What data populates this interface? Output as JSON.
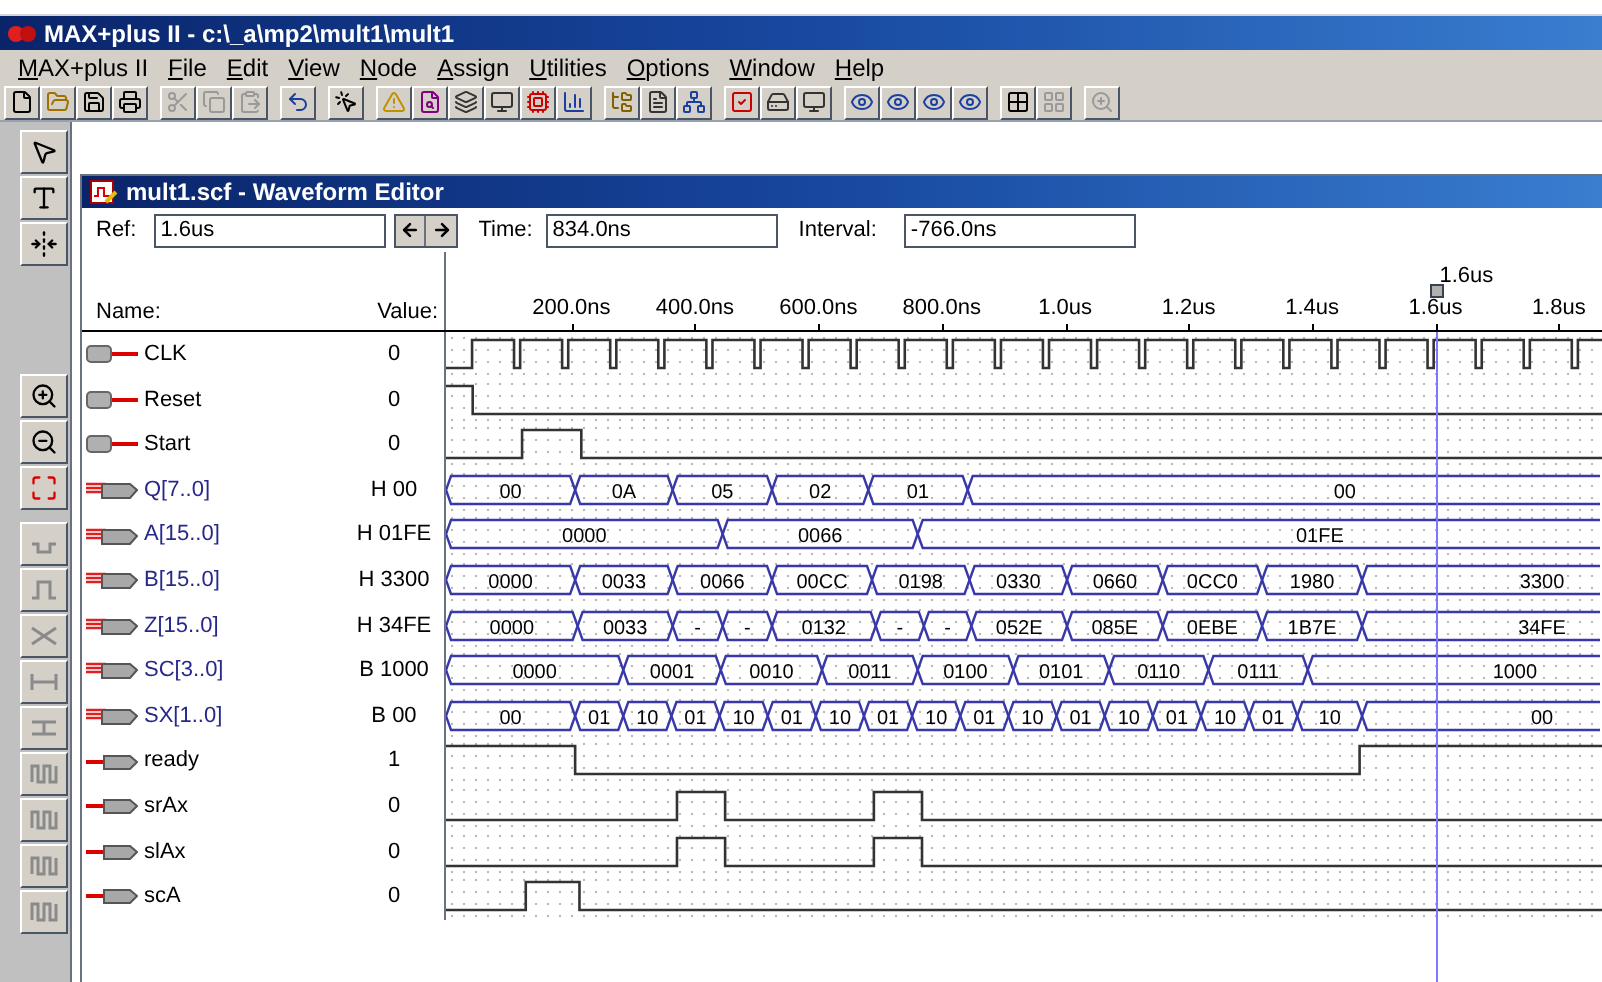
{
  "window": {
    "title": "MAX+plus II - c:\\_a\\mp2\\mult1\\mult1"
  },
  "menu": [
    "MAX+plus II",
    "File",
    "Edit",
    "View",
    "Node",
    "Assign",
    "Utilities",
    "Options",
    "Window",
    "Help"
  ],
  "editor": {
    "title": "mult1.scf - Waveform Editor",
    "ref": {
      "label": "Ref:",
      "value": "1.6us"
    },
    "time": {
      "label": "Time:",
      "value": "834.0ns"
    },
    "interval": {
      "label": "Interval:",
      "value": "-766.0ns"
    },
    "name_header": "Name:",
    "value_header": "Value:",
    "cursor_label": "1.6us",
    "ticks": [
      "200.0ns",
      "400.0ns",
      "600.0ns",
      "800.0ns",
      "1.0us",
      "1.2us",
      "1.4us",
      "1.6us",
      "1.8us"
    ],
    "signals": [
      {
        "name": "CLK",
        "kind": "clock",
        "value": "0"
      },
      {
        "name": "Reset",
        "kind": "input",
        "value": "0"
      },
      {
        "name": "Start",
        "kind": "input",
        "value": "0"
      },
      {
        "name": "Q[7..0]",
        "kind": "bus",
        "value": "H 00",
        "segments": [
          "00",
          "0A",
          "05",
          "02",
          "01",
          "00"
        ]
      },
      {
        "name": "A[15..0]",
        "kind": "bus",
        "value": "H 01FE",
        "segments": [
          "0000",
          "0066",
          "01FE"
        ]
      },
      {
        "name": "B[15..0]",
        "kind": "bus",
        "value": "H 3300",
        "segments": [
          "0000",
          "0033",
          "0066",
          "00CC",
          "0198",
          "0330",
          "0660",
          "0CC0",
          "1980",
          "3300"
        ]
      },
      {
        "name": "Z[15..0]",
        "kind": "bus",
        "value": "H 34FE",
        "segments": [
          "0000",
          "0033",
          "-",
          "-",
          "0132",
          "-",
          "-",
          "052E",
          "085E",
          "0EBE",
          "1B7E",
          "34FE"
        ]
      },
      {
        "name": "SC[3..0]",
        "kind": "bus",
        "value": "B 1000",
        "segments": [
          "0000",
          "0001",
          "0010",
          "0011",
          "0100",
          "0101",
          "0110",
          "0111",
          "1000"
        ]
      },
      {
        "name": "SX[1..0]",
        "kind": "bus",
        "value": "B 00",
        "segments": [
          "00",
          "01",
          "10",
          "01",
          "10",
          "01",
          "10",
          "01",
          "10",
          "01",
          "10",
          "01",
          "10",
          "01",
          "10",
          "01",
          "10",
          "00"
        ]
      },
      {
        "name": "ready",
        "kind": "output",
        "value": "1"
      },
      {
        "name": "srAx",
        "kind": "output",
        "value": "0"
      },
      {
        "name": "slAx",
        "kind": "output",
        "value": "0"
      },
      {
        "name": "scA",
        "kind": "output",
        "value": "0"
      }
    ]
  }
}
